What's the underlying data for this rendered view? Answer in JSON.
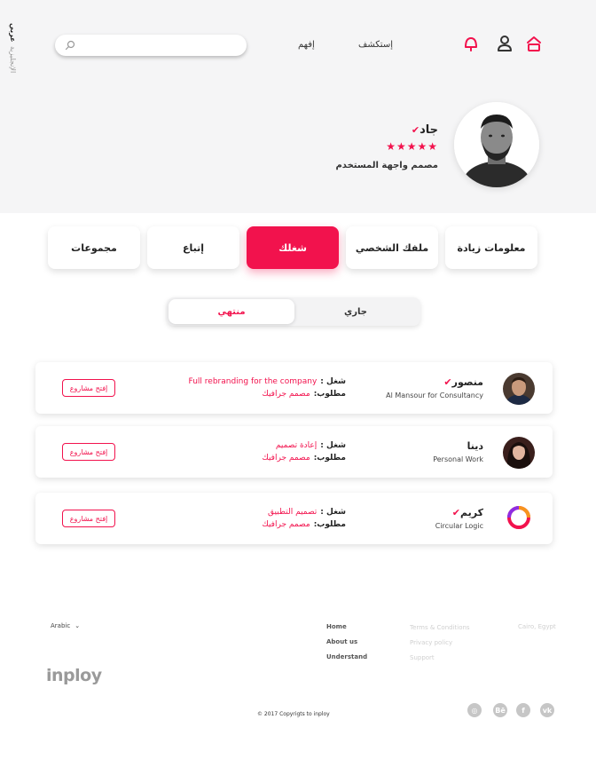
{
  "colors": {
    "accent": "#f2124d",
    "band": "#f5f5f6",
    "muted": "#c6c6c6"
  },
  "lang": {
    "arabic": "عربي",
    "english": "الإنجليزية"
  },
  "header": {
    "search_placeholder": "",
    "nav": {
      "explore": "إستكشف",
      "understand": "إفهم"
    },
    "icons": [
      "notification-bell-icon",
      "user-icon",
      "home-icon"
    ]
  },
  "profile": {
    "name": "جاد",
    "stars": "★★★★★",
    "rating": 5,
    "role": "مصمم واجهة المستخدم",
    "verified": true
  },
  "tabs": [
    {
      "label": "مجموعات",
      "active": false
    },
    {
      "label": "إتباع",
      "active": false
    },
    {
      "label": "شغلك",
      "active": true
    },
    {
      "label": "ملفك الشخصي",
      "active": false
    },
    {
      "label": "معلومات زيادة",
      "active": false
    }
  ],
  "segment": {
    "done": "منتهي",
    "ongoing": "جاري",
    "selected": "منتهي"
  },
  "cards": [
    {
      "name": "منصور",
      "verified": true,
      "company": "Al Mansour for Consultancy",
      "work_label": "شغل :",
      "work_value": "Full rebranding for the company",
      "req_label": "مطلوب:",
      "req_value": "مصمم جرافيك",
      "button": "إفتح مشاروع"
    },
    {
      "name": "دينا",
      "verified": false,
      "company": "Personal Work",
      "work_label": "شغل :",
      "work_value": "إعادة تصميم",
      "req_label": "مطلوب:",
      "req_value": "مصمم جرافيك",
      "button": "إفتح مشاروع"
    },
    {
      "name": "كريم",
      "verified": true,
      "company": "Circular Logic",
      "work_label": "شغل :",
      "work_value": "تصميم التطبيق",
      "req_label": "مطلوب:",
      "req_value": "مصمم جرافيك",
      "button": "إفتح مشاروع"
    }
  ],
  "footer": {
    "language": "Arabic",
    "nav": [
      "Home",
      "About us",
      "Understand"
    ],
    "legal": [
      "Terms & Conditions",
      "Privacy policy",
      "Support"
    ],
    "location": "Cairo, Egypt",
    "logo": "inploy",
    "copyright": "© 2017  Copyrigts to inploy",
    "social": [
      "instagram-icon",
      "behance-icon",
      "facebook-icon",
      "vk-icon"
    ]
  }
}
